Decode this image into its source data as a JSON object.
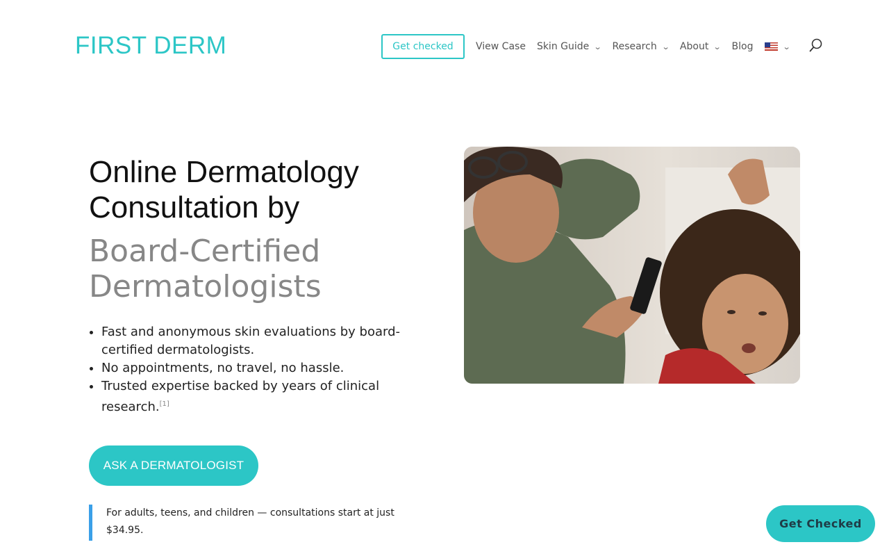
{
  "header": {
    "logo": "FIRST DERM",
    "cta": "Get checked",
    "nav": [
      {
        "label": "View Case",
        "dropdown": false
      },
      {
        "label": "Skin Guide",
        "dropdown": true
      },
      {
        "label": "Research",
        "dropdown": true
      },
      {
        "label": "About",
        "dropdown": true
      },
      {
        "label": "Blog",
        "dropdown": false
      }
    ],
    "language_icon": "us-flag-icon",
    "search_icon": "search-icon"
  },
  "hero": {
    "title_line1": "Online Dermatology",
    "title_line2": "Consultation by",
    "subtitle_line1": "Board-Certified",
    "subtitle_line2": "Dermatologists",
    "bullets": [
      "Fast and anonymous skin evaluations by board-certified dermatologists.",
      "No appointments, no travel, no hassle.",
      "Trusted expertise backed by years of clinical research."
    ],
    "footnote": "[1]",
    "ask_button": "ASK A DERMATOLOGIST",
    "note": "For adults, teens, and children — consultations start at just $34.95."
  },
  "floating_button": "Get Checked",
  "colors": {
    "accent": "#2cc6c6",
    "quote_border": "#3aa0e8",
    "subtitle_gray": "#878787"
  }
}
